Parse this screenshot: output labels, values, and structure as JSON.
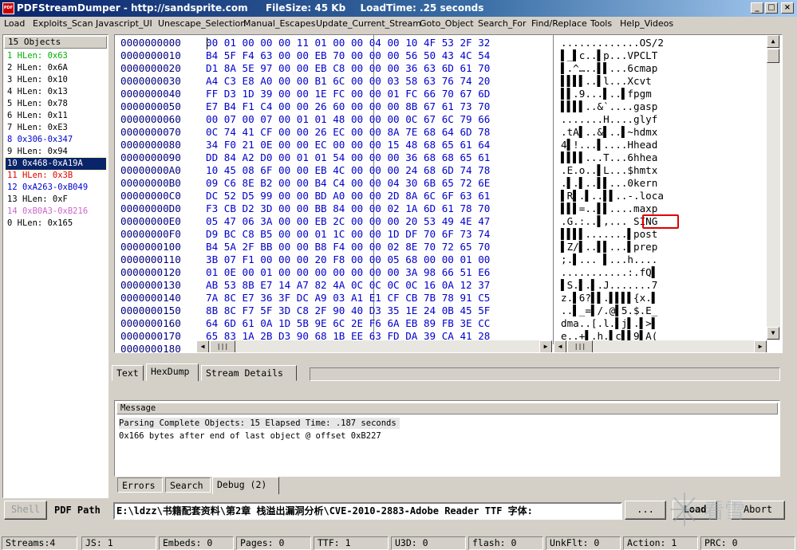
{
  "window": {
    "title": "PDFStreamDumper - http://sandsprite.com",
    "filesize": "FileSize: 45 Kb",
    "loadtime": "LoadTime: .25 seconds",
    "icon_letters": "PDF",
    "controls": [
      "minimize-icon",
      "maximize-icon",
      "close-icon"
    ]
  },
  "menu": [
    "Load",
    "Exploits_Scan",
    "Javascript_UI",
    "Unescape_Selection",
    "Manual_Escapes",
    "Update_Current_Stream",
    "Goto_Object",
    "Search_For",
    "Find/Replace",
    "Tools",
    "Help_Videos"
  ],
  "objects": {
    "header": "15 Objects",
    "items": [
      {
        "label": "1 HLen: 0x63",
        "color": "#00b000"
      },
      {
        "label": "2 HLen: 0x6A",
        "color": "#000000"
      },
      {
        "label": "3 HLen: 0x10",
        "color": "#000000"
      },
      {
        "label": "4 HLen: 0x13",
        "color": "#000000"
      },
      {
        "label": "5 HLen: 0x78",
        "color": "#000000"
      },
      {
        "label": "6 HLen: 0x11",
        "color": "#000000"
      },
      {
        "label": "7 HLen: 0xE3",
        "color": "#000000"
      },
      {
        "label": "8 0x306-0x347",
        "color": "#0000cc"
      },
      {
        "label": "9 HLen: 0x94",
        "color": "#000000"
      },
      {
        "label": "10 0x468-0xA19A",
        "color": "#ffffff",
        "selected": true
      },
      {
        "label": "11 HLen: 0x3B",
        "color": "#e00000"
      },
      {
        "label": "12 0xA263-0xB049",
        "color": "#0000cc"
      },
      {
        "label": "13 HLen: 0xF",
        "color": "#000000"
      },
      {
        "label": "14 0xB0A3-0xB216",
        "color": "#cc66cc"
      },
      {
        "label": "0 HLen: 0x165",
        "color": "#000000"
      }
    ]
  },
  "hexdump": {
    "rows": [
      {
        "offset": "0000000000",
        "bytes": "00 01 00 00 00 11 01 00 00 04 00 10 4F 53 2F 32",
        "ascii": ".............OS/2"
      },
      {
        "offset": "0000000010",
        "bytes": "B4 5F F4 63 00 00 EB 70 00 00 00 56 50 43 4C 54",
        "ascii": "▌_▌c..▌p...VPCLT"
      },
      {
        "offset": "0000000020",
        "bytes": "D1 8A 5E 97 00 00 EB C8 00 00 00 36 63 6D 61 70",
        "ascii": "▌.^…..▌▌...6cmap"
      },
      {
        "offset": "0000000030",
        "bytes": "A4 C3 E8 A0 00 00 B1 6C 00 00 03 58 63 76 74 20",
        "ascii": "▌▌▌▌..▌l...Xcvt"
      },
      {
        "offset": "0000000040",
        "bytes": "FF D3 1D 39 00 00 1E FC 00 00 01 FC 66 70 67 6D",
        "ascii": "▌▌.9...▌..▌fpgm"
      },
      {
        "offset": "0000000050",
        "bytes": "E7 B4 F1 C4 00 00 26 60 00 00 00 8B 67 61 73 70",
        "ascii": "▌▌▌▌..&`....gasp"
      },
      {
        "offset": "0000000060",
        "bytes": "00 07 00 07 00 01 01 48 00 00 00 0C 67 6C 79 66",
        "ascii": ".......H....glyf"
      },
      {
        "offset": "0000000070",
        "bytes": "0C 74 41 CF 00 00 26 EC 00 00 8A 7E 68 64 6D 78",
        "ascii": ".tA▌..&▌..▌~hdmx"
      },
      {
        "offset": "0000000080",
        "bytes": "34 F0 21 0E 00 00 EC 00 00 00 15 48 68 65 61 64",
        "ascii": "4▌!...▌....Hhead"
      },
      {
        "offset": "0000000090",
        "bytes": "DD 84 A2 D0 00 01 01 54 00 00 00 36 68 68 65 61",
        "ascii": "▌▌▌▌...T...6hhea"
      },
      {
        "offset": "00000000A0",
        "bytes": "10 45 08 6F 00 00 EB 4C 00 00 00 24 68 6D 74 78",
        "ascii": ".E.o..▌L...$hmtx"
      },
      {
        "offset": "00000000B0",
        "bytes": "09 C6 8E B2 00 00 B4 C4 00 00 04 30 6B 65 72 6E",
        "ascii": ".▌.▌..▌▌...0kern"
      },
      {
        "offset": "00000000C0",
        "bytes": "DC 52 D5 99 00 00 BD A0 00 00 2D 8A 6C 6F 63 61",
        "ascii": "▌R▌.▌..▌▌..-.loca"
      },
      {
        "offset": "00000000D0",
        "bytes": "F3 CB D2 3D 00 00 BB 84 00 00 02 1A 6D 61 78 70",
        "ascii": "▌▌▌=..▌▌....maxp"
      },
      {
        "offset": "00000000E0",
        "bytes": "05 47 06 3A 00 00 EB 2C 00 00 00 20 53 49 4E 47",
        "ascii": ".G.:..▌,... SING"
      },
      {
        "offset": "00000000F0",
        "bytes": "D9 BC C8 B5 00 00 01 1C 00 00 1D DF 70 6F 73 74",
        "ascii": "▌▌▌▌.......▌post"
      },
      {
        "offset": "0000000100",
        "bytes": "B4 5A 2F BB 00 00 B8 F4 00 00 02 8E 70 72 65 70",
        "ascii": "▌Z/▌..▌▌...▌prep"
      },
      {
        "offset": "0000000110",
        "bytes": "3B 07 F1 00 00 00 20 F8 00 00 05 68 00 00 01 00",
        "ascii": ";.▌... ▌...h...."
      },
      {
        "offset": "0000000120",
        "bytes": "01 0E 00 01 00 00 00 00 00 00 00 3A 98 66 51 E6",
        "ascii": "...........:.fQ▌"
      },
      {
        "offset": "0000000130",
        "bytes": "AB 53 8B E7 14 A7 82 4A 0C 0C 0C 0C 16 0A 12 37",
        "ascii": "▌S.▌.▌.J.......7"
      },
      {
        "offset": "0000000140",
        "bytes": "7A 8C E7 36 3F DC A9 03 A1 E1 CF CB 7B 78 91 C5",
        "ascii": "z.▌6?▌▌.▌▌▌▌{x.▌"
      },
      {
        "offset": "0000000150",
        "bytes": "8B 8C F7 5F 3D C8 2F 90 40 D3 35 1E 24 0B 45 5F",
        "ascii": "..▌_=▌/.@▌5.$.E_"
      },
      {
        "offset": "0000000160",
        "bytes": "64 6D 61 0A 1D 5B 9E 6C 2E F6 6A EB 89 FB 3E CC",
        "ascii": "dma..[.l.▌j▌.▌>▌"
      },
      {
        "offset": "0000000170",
        "bytes": "65 83 1A 2B D3 90 68 1B EE 63 FD DA 39 CA 41 28",
        "ascii": "e..+▌.h.▌c▌▌9▌A("
      },
      {
        "offset": "0000000180",
        "bytes": "",
        "ascii": ""
      }
    ]
  },
  "tabs_top": [
    "Text",
    "HexDump",
    "Stream Details"
  ],
  "message": {
    "header": "Message",
    "lines": [
      "Parsing Complete Objects: 15  Elapsed Time: .187 seconds",
      "0x166 bytes after end of last object @ offset 0xB227"
    ]
  },
  "tabs_bottom": [
    "Errors",
    "Search",
    "Debug (2)"
  ],
  "bottom": {
    "shell_label": "Shell",
    "pdf_path_label": "PDF Path",
    "path_value": "E:\\ldzz\\书籍配套资料\\第2章 栈溢出漏洞分析\\CVE-2010-2883-Adobe Reader TTF 字体:",
    "browse_label": "...",
    "load_label": "Load",
    "abort_label": "Abort"
  },
  "status": [
    "Streams:4",
    "JS: 1",
    "Embeds: 0",
    "Pages: 0",
    "TTF: 1",
    "U3D: 0",
    "flash: 0",
    "UnkFlt: 0",
    "Action: 1",
    "PRC: 0"
  ],
  "watermark_text": "看雪"
}
